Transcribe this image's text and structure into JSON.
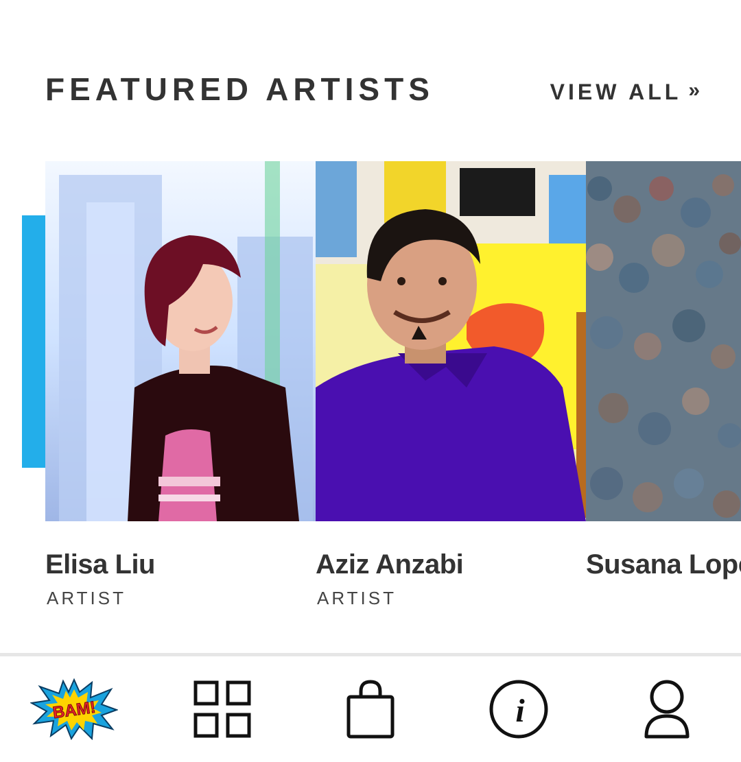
{
  "section": {
    "title": "FEATURED ARTISTS",
    "view_all_label": "VIEW ALL",
    "view_all_chevron": "»"
  },
  "artists": [
    {
      "name": "Elisa Liu",
      "role": "ARTIST"
    },
    {
      "name": "Aziz Anzabi",
      "role": "ARTIST"
    },
    {
      "name": "Susana Lopez",
      "role": ""
    }
  ],
  "bottom_nav": {
    "items": [
      {
        "icon": "bam-logo-icon",
        "label": "BAM!"
      },
      {
        "icon": "grid-icon"
      },
      {
        "icon": "shopping-bag-icon"
      },
      {
        "icon": "info-icon",
        "label": "i"
      },
      {
        "icon": "user-icon"
      }
    ]
  },
  "colors": {
    "accent": "#23aeea",
    "text": "#333333",
    "divider": "#e6e6e6"
  }
}
